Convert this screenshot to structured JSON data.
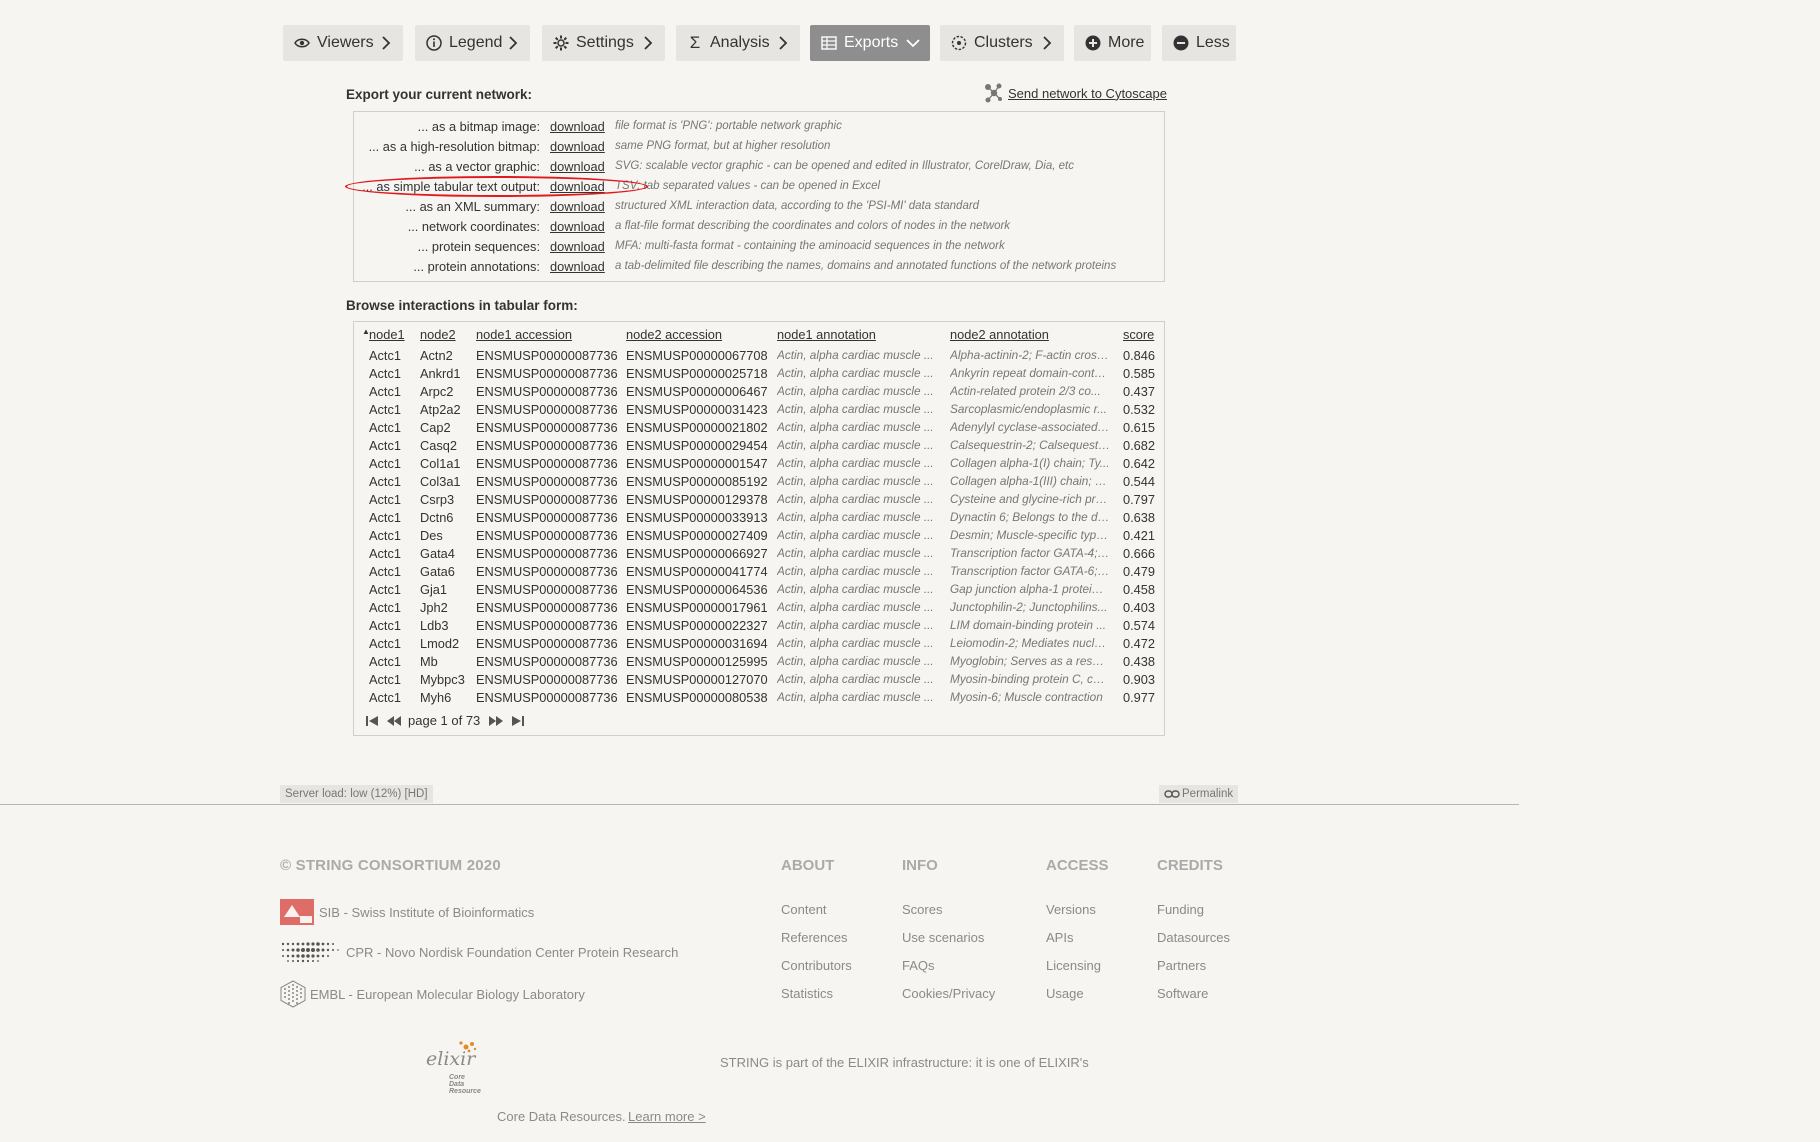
{
  "toolbar": {
    "buttons": [
      {
        "label": "Viewers"
      },
      {
        "label": "Legend"
      },
      {
        "label": "Settings"
      },
      {
        "label": "Analysis"
      },
      {
        "label": "Exports"
      },
      {
        "label": "Clusters"
      },
      {
        "label": "More"
      },
      {
        "label": "Less"
      }
    ]
  },
  "exports": {
    "title": "Export your current network:",
    "cytoscape": "Send network to Cytoscape",
    "rows": [
      {
        "label": "... as a bitmap image:",
        "link": "download",
        "desc": "file format is 'PNG': portable network graphic"
      },
      {
        "label": "... as a high-resolution bitmap:",
        "link": "download",
        "desc": "same PNG format, but at higher resolution"
      },
      {
        "label": "... as a vector graphic:",
        "link": "download",
        "desc": "SVG: scalable vector graphic - can be opened and edited in Illustrator, CorelDraw, Dia, etc"
      },
      {
        "label": "... as simple tabular text output:",
        "link": "download",
        "desc": "TSV: tab separated values - can be opened in Excel"
      },
      {
        "label": "... as an XML summary:",
        "link": "download",
        "desc": "structured XML interaction data, according to the 'PSI-MI' data standard"
      },
      {
        "label": "... network coordinates:",
        "link": "download",
        "desc": "a flat-file format describing the coordinates and colors of nodes in the network"
      },
      {
        "label": "... protein sequences:",
        "link": "download",
        "desc": "MFA: multi-fasta format - containing the aminoacid sequences in the network"
      },
      {
        "label": "... protein annotations:",
        "link": "download",
        "desc": "a tab-delimited file describing the names, domains and annotated functions of the network proteins"
      }
    ]
  },
  "browse": {
    "title": "Browse interactions in tabular form:",
    "columns": [
      "node1",
      "node2",
      "node1 accession",
      "node2 accession",
      "node1 annotation",
      "node2 annotation",
      "score"
    ],
    "rows": [
      [
        "Actc1",
        "Actn2",
        "ENSMUSP00000087736",
        "ENSMUSP00000067708",
        "Actin, alpha cardiac muscle ...",
        "Alpha-actinin-2; F-actin cross...",
        "0.846"
      ],
      [
        "Actc1",
        "Ankrd1",
        "ENSMUSP00000087736",
        "ENSMUSP00000025718",
        "Actin, alpha cardiac muscle ...",
        "Ankyrin repeat domain-conta...",
        "0.585"
      ],
      [
        "Actc1",
        "Arpc2",
        "ENSMUSP00000087736",
        "ENSMUSP00000006467",
        "Actin, alpha cardiac muscle ...",
        "Actin-related protein 2/3 co...",
        "0.437"
      ],
      [
        "Actc1",
        "Atp2a2",
        "ENSMUSP00000087736",
        "ENSMUSP00000031423",
        "Actin, alpha cardiac muscle ...",
        "Sarcoplasmic/endoplasmic r...",
        "0.532"
      ],
      [
        "Actc1",
        "Cap2",
        "ENSMUSP00000087736",
        "ENSMUSP00000021802",
        "Actin, alpha cardiac muscle ...",
        "Adenylyl cyclase-associated ...",
        "0.615"
      ],
      [
        "Actc1",
        "Casq2",
        "ENSMUSP00000087736",
        "ENSMUSP00000029454",
        "Actin, alpha cardiac muscle ...",
        "Calsequestrin-2; Calsequestr...",
        "0.682"
      ],
      [
        "Actc1",
        "Col1a1",
        "ENSMUSP00000087736",
        "ENSMUSP00000001547",
        "Actin, alpha cardiac muscle ...",
        "Collagen alpha-1(I) chain; Ty...",
        "0.642"
      ],
      [
        "Actc1",
        "Col3a1",
        "ENSMUSP00000087736",
        "ENSMUSP00000085192",
        "Actin, alpha cardiac muscle ...",
        "Collagen alpha-1(III) chain; C...",
        "0.544"
      ],
      [
        "Actc1",
        "Csrp3",
        "ENSMUSP00000087736",
        "ENSMUSP00000129378",
        "Actin, alpha cardiac muscle ...",
        "Cysteine and glycine-rich pro...",
        "0.797"
      ],
      [
        "Actc1",
        "Dctn6",
        "ENSMUSP00000087736",
        "ENSMUSP00000033913",
        "Actin, alpha cardiac muscle ...",
        "Dynactin 6; Belongs to the dy...",
        "0.638"
      ],
      [
        "Actc1",
        "Des",
        "ENSMUSP00000087736",
        "ENSMUSP00000027409",
        "Actin, alpha cardiac muscle ...",
        "Desmin; Muscle-specific type...",
        "0.421"
      ],
      [
        "Actc1",
        "Gata4",
        "ENSMUSP00000087736",
        "ENSMUSP00000066927",
        "Actin, alpha cardiac muscle ...",
        "Transcription factor GATA-4; ...",
        "0.666"
      ],
      [
        "Actc1",
        "Gata6",
        "ENSMUSP00000087736",
        "ENSMUSP00000041774",
        "Actin, alpha cardiac muscle ...",
        "Transcription factor GATA-6; ...",
        "0.479"
      ],
      [
        "Actc1",
        "Gja1",
        "ENSMUSP00000087736",
        "ENSMUSP00000064536",
        "Actin, alpha cardiac muscle ...",
        "Gap junction alpha-1 protein; ...",
        "0.458"
      ],
      [
        "Actc1",
        "Jph2",
        "ENSMUSP00000087736",
        "ENSMUSP00000017961",
        "Actin, alpha cardiac muscle ...",
        "Junctophilin-2; Junctophilins...",
        "0.403"
      ],
      [
        "Actc1",
        "Ldb3",
        "ENSMUSP00000087736",
        "ENSMUSP00000022327",
        "Actin, alpha cardiac muscle ...",
        "LIM domain-binding protein ...",
        "0.574"
      ],
      [
        "Actc1",
        "Lmod2",
        "ENSMUSP00000087736",
        "ENSMUSP00000031694",
        "Actin, alpha cardiac muscle ...",
        "Leiomodin-2; Mediates nucle...",
        "0.472"
      ],
      [
        "Actc1",
        "Mb",
        "ENSMUSP00000087736",
        "ENSMUSP00000125995",
        "Actin, alpha cardiac muscle ...",
        "Myoglobin; Serves as a reser...",
        "0.438"
      ],
      [
        "Actc1",
        "Mybpc3",
        "ENSMUSP00000087736",
        "ENSMUSP00000127070",
        "Actin, alpha cardiac muscle ...",
        "Myosin-binding protein C, car...",
        "0.903"
      ],
      [
        "Actc1",
        "Myh6",
        "ENSMUSP00000087736",
        "ENSMUSP00000080538",
        "Actin, alpha cardiac muscle ...",
        "Myosin-6; Muscle contraction",
        "0.977"
      ]
    ],
    "pager": "page 1 of 73"
  },
  "status": {
    "server_load": "Server load: low (12%) [HD]",
    "permalink": "Permalink"
  },
  "footer": {
    "copyright": "© STRING CONSORTIUM 2020",
    "institutions": [
      "SIB - Swiss Institute of Bioinformatics",
      "CPR - Novo Nordisk Foundation Center Protein Research",
      "EMBL - European Molecular Biology Laboratory"
    ],
    "columns": [
      {
        "title": "ABOUT",
        "links": [
          "Content",
          "References",
          "Contributors",
          "Statistics"
        ]
      },
      {
        "title": "INFO",
        "links": [
          "Scores",
          "Use scenarios",
          "FAQs",
          "Cookies/Privacy"
        ]
      },
      {
        "title": "ACCESS",
        "links": [
          "Versions",
          "APIs",
          "Licensing",
          "Usage"
        ]
      },
      {
        "title": "CREDITS",
        "links": [
          "Funding",
          "Datasources",
          "Partners",
          "Software"
        ]
      }
    ],
    "elixir_logo_text": "elixir",
    "elixir_logo_sub": "Core Data Resource",
    "elixir_text": "STRING is part of the ELIXIR infrastructure: it is one of ELIXIR's",
    "core_text": "Core Data Resources.",
    "learn_more": "Learn more >"
  },
  "colors": {
    "highlight": "#e0191f",
    "active_tab": "#8e8e8e",
    "tab_bg": "#e6e5e1",
    "background": "#f6f5f1"
  }
}
